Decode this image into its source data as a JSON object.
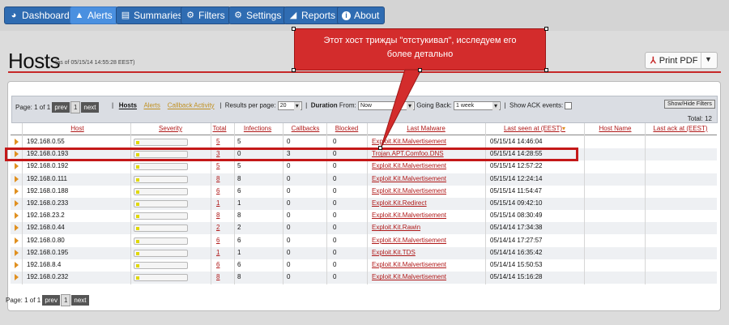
{
  "nav": {
    "items": [
      {
        "label": "Dashboard",
        "icon": "dashboard-icon",
        "glyph": "◕",
        "active": false
      },
      {
        "label": "Alerts",
        "icon": "alert-icon",
        "glyph": "▲",
        "active": true
      },
      {
        "label": "Summaries",
        "icon": "list-icon",
        "glyph": "▤",
        "active": false
      },
      {
        "label": "Filters",
        "icon": "filter-icon",
        "glyph": "⚙",
        "active": false
      },
      {
        "label": "Settings",
        "icon": "gear-icon",
        "glyph": "⚙",
        "active": false
      },
      {
        "label": "Reports",
        "icon": "chart-icon",
        "glyph": "◢",
        "active": false
      },
      {
        "label": "About",
        "icon": "info-icon",
        "glyph": "i",
        "active": false
      }
    ]
  },
  "page": {
    "title": "Hosts",
    "subtitle": "(as of 05/15/14 14:55:28 EEST)",
    "print_label": "Print PDF",
    "pdf_glyph": "⅄"
  },
  "callout": {
    "line1": "Этот хост трижды \"отстукивал\", исследуем его",
    "line2": "более детально"
  },
  "filterbar": {
    "page_label": "Page: 1 of 1",
    "prev": "prev",
    "page_num": "1",
    "next": "next",
    "sep": "|",
    "hosts": "Hosts",
    "alerts": "Alerts",
    "callback": "Callback Activity",
    "per_page_label": "Results per page:",
    "per_page": "20",
    "duration_label": "Duration",
    "from_label": "From:",
    "from_value": "Now",
    "going_back_label": "Going Back:",
    "going_back_value": "1 week",
    "show_ack_label": "Show ACK events:",
    "showhide": "Show/Hide Filters",
    "total": "Total: 12"
  },
  "table": {
    "columns": [
      "Host",
      "Severity",
      "Total",
      "Infections",
      "Callbacks",
      "Blocked",
      "Last Malware",
      "Last seen at (EEST)",
      "Host Name",
      "Last ack at (EEST)"
    ],
    "sort_glyph": "▾",
    "rows": [
      {
        "host": "192.168.0.55",
        "severity": 0.05,
        "total": "5",
        "infections": "5",
        "callbacks": "0",
        "blocked": "0",
        "malware": "Exploit.Kit.Malvertisement",
        "last_seen": "05/15/14 14:46:04"
      },
      {
        "host": "192.168.0.193",
        "severity": 0.05,
        "total": "3",
        "infections": "0",
        "callbacks": "3",
        "blocked": "0",
        "malware": "Trojan.APT.Comfoo.DNS",
        "last_seen": "05/15/14 14:28:55"
      },
      {
        "host": "192.168.0.192",
        "severity": 0.05,
        "total": "5",
        "infections": "5",
        "callbacks": "0",
        "blocked": "0",
        "malware": "Exploit.Kit.Malvertisement",
        "last_seen": "05/15/14 12:57:22"
      },
      {
        "host": "192.168.0.111",
        "severity": 0.05,
        "total": "8",
        "infections": "8",
        "callbacks": "0",
        "blocked": "0",
        "malware": "Exploit.Kit.Malvertisement",
        "last_seen": "05/15/14 12:24:14"
      },
      {
        "host": "192.168.0.188",
        "severity": 0.05,
        "total": "6",
        "infections": "6",
        "callbacks": "0",
        "blocked": "0",
        "malware": "Exploit.Kit.Malvertisement",
        "last_seen": "05/15/14 11:54:47"
      },
      {
        "host": "192.168.0.233",
        "severity": 0.05,
        "total": "1",
        "infections": "1",
        "callbacks": "0",
        "blocked": "0",
        "malware": "Exploit.Kit.Redirect",
        "last_seen": "05/15/14 09:42:10"
      },
      {
        "host": "192.168.23.2",
        "severity": 0.05,
        "total": "8",
        "infections": "8",
        "callbacks": "0",
        "blocked": "0",
        "malware": "Exploit.Kit.Malvertisement",
        "last_seen": "05/15/14 08:30:49"
      },
      {
        "host": "192.168.0.44",
        "severity": 0.05,
        "total": "2",
        "infections": "2",
        "callbacks": "0",
        "blocked": "0",
        "malware": "Exploit.Kit.Rawin",
        "last_seen": "05/14/14 17:34:38"
      },
      {
        "host": "192.168.0.80",
        "severity": 0.05,
        "total": "6",
        "infections": "6",
        "callbacks": "0",
        "blocked": "0",
        "malware": "Exploit.Kit.Malvertisement",
        "last_seen": "05/14/14 17:27:57"
      },
      {
        "host": "192.168.0.195",
        "severity": 0.05,
        "total": "1",
        "infections": "1",
        "callbacks": "0",
        "blocked": "0",
        "malware": "Exploit.Kit.TDS",
        "last_seen": "05/14/14 16:35:42"
      },
      {
        "host": "192.168.8.4",
        "severity": 0.05,
        "total": "6",
        "infections": "6",
        "callbacks": "0",
        "blocked": "0",
        "malware": "Exploit.Kit.Malvertisement",
        "last_seen": "05/14/14 15:50:53"
      },
      {
        "host": "192.168.0.232",
        "severity": 0.05,
        "total": "8",
        "infections": "8",
        "callbacks": "0",
        "blocked": "0",
        "malware": "Exploit.Kit.Malvertisement",
        "last_seen": "05/14/14 15:16:28"
      }
    ]
  },
  "bottom_pager": {
    "page_label": "Page: 1 of 1",
    "prev": "prev",
    "page_num": "1",
    "next": "next"
  },
  "colors": {
    "accent": "#c62828",
    "nav_blue": "#2f6cb2",
    "severity": "#e0d800"
  }
}
